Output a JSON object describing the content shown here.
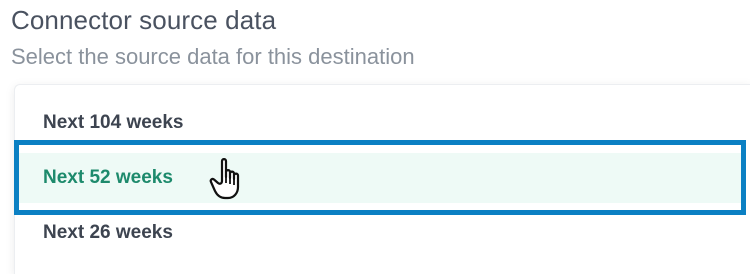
{
  "header": {
    "title": "Connector source data",
    "subtitle": "Select the source data for this destination"
  },
  "dropdown": {
    "options": [
      {
        "label": "Next 104 weeks",
        "state": "default"
      },
      {
        "label": "Next 52 weeks",
        "state": "hovered"
      },
      {
        "label": "Next 26 weeks",
        "state": "default"
      }
    ]
  },
  "colors": {
    "highlight_border": "#0b80c3",
    "hover_background": "#eefaf6",
    "hover_text": "#1d8a6c",
    "option_text": "#3d4450"
  },
  "cursor": {
    "icon": "hand-pointer-icon"
  }
}
